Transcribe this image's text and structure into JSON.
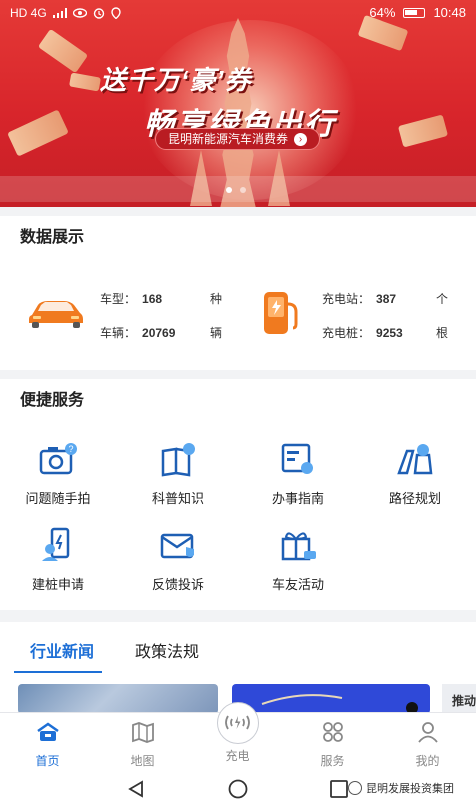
{
  "status_bar": {
    "signal": "HD 4G",
    "battery": "64%",
    "time": "10:48"
  },
  "banner": {
    "headline_1": "送千万‘豪’券",
    "headline_2": "畅享绿色出行",
    "subtitle": "昆明新能源汽车消费券",
    "active_dot": 1,
    "dot_count": 2
  },
  "data_section": {
    "title": "数据展示",
    "vehicle": {
      "model_label": "车型：",
      "model_value": "168",
      "model_unit": "种",
      "count_label": "车辆：",
      "count_value": "20769",
      "count_unit": "辆"
    },
    "charging": {
      "station_label": "充电站：",
      "station_value": "387",
      "station_unit": "个",
      "pile_label": "充电桩：",
      "pile_value": "9253",
      "pile_unit": "根"
    }
  },
  "services": {
    "title": "便捷服务",
    "items": [
      {
        "label": "问题随手拍",
        "icon": "camera-question-icon"
      },
      {
        "label": "科普知识",
        "icon": "book-bulb-icon"
      },
      {
        "label": "办事指南",
        "icon": "guide-doc-icon"
      },
      {
        "label": "路径规划",
        "icon": "map-pin-icon"
      },
      {
        "label": "建桩申请",
        "icon": "charging-pile-apply-icon"
      },
      {
        "label": "反馈投诉",
        "icon": "feedback-envelope-icon"
      },
      {
        "label": "车友活动",
        "icon": "gift-icon"
      }
    ]
  },
  "news": {
    "tabs": [
      "行业新闻",
      "政策法规"
    ],
    "active_tab": 0,
    "side_card_text": "推动"
  },
  "bottom_nav": {
    "items": [
      {
        "label": "首页",
        "icon": "home-icon"
      },
      {
        "label": "地图",
        "icon": "map-icon"
      },
      {
        "label": "充电",
        "icon": "charging-icon"
      },
      {
        "label": "服务",
        "icon": "service-icon"
      },
      {
        "label": "我的",
        "icon": "profile-icon"
      }
    ],
    "active": 0
  },
  "watermark": "昆明发展投资集团",
  "colors": {
    "accent": "#1d6fd6",
    "banner_red": "#d8252b",
    "icon_blue": "#1e5fb4"
  }
}
